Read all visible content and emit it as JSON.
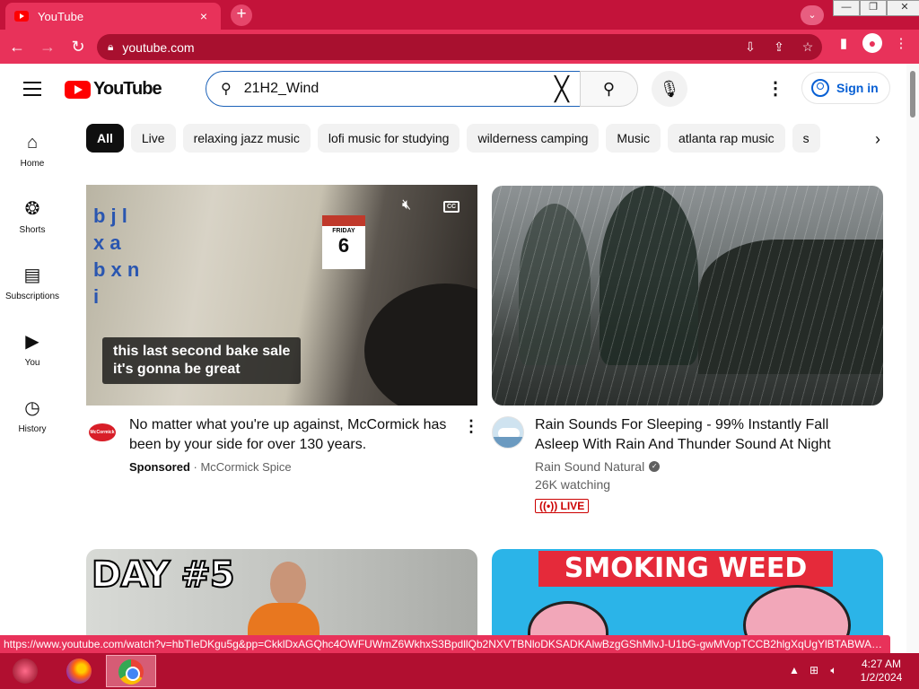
{
  "browser": {
    "tab_title": "YouTube",
    "tab_close": "×",
    "new_tab": "+",
    "tab_search": "⌄",
    "url": "youtube.com",
    "status_url": "https://www.youtube.com/watch?v=hbTIeDKgu5g&pp=CkklDxAGQhc4OWFUWmZ6WkhxS3BpdllQb2NXVTBNloDKSADKAlwBzgGShMlvJ-U1bG-gwMVopTCCB2hlgXqUgYlBTABWAJoA...",
    "win_minimize": "—",
    "win_maximize": "❐",
    "win_close": "✕"
  },
  "header": {
    "logo_text": "YouTube",
    "search_value": "21H2_Wind",
    "clear_symbol": "╳",
    "signin_label": "Sign in"
  },
  "sidebar": {
    "items": [
      {
        "label": "Home",
        "icon": "⌂"
      },
      {
        "label": "Shorts",
        "icon": "❂"
      },
      {
        "label": "Subscriptions",
        "icon": "▤"
      },
      {
        "label": "You",
        "icon": "▶"
      },
      {
        "label": "History",
        "icon": "◷"
      }
    ]
  },
  "chips": [
    "All",
    "Live",
    "relaxing jazz music",
    "lofi music for studying",
    "wilderness camping",
    "Music",
    "atlanta rap music",
    "s"
  ],
  "videos": [
    {
      "title": "No matter what you're up against, McCormick has been by your side for over 130 years.",
      "sponsored": "Sponsored",
      "separator": " · ",
      "channel": "McCormick Spice",
      "caption_line1": "this last second bake sale",
      "caption_line2": "it's gonna be great",
      "letters": "b j l\nx a\nb x n\ni",
      "cal_day": "FRIDAY",
      "cal_num": "6",
      "avatar_text": "McCormick",
      "cc_label": "CC"
    },
    {
      "title": "Rain Sounds For Sleeping - 99% Instantly Fall Asleep With Rain And Thunder Sound At Night",
      "channel": "Rain Sound Natural",
      "verified": "✓",
      "watching": "26K watching",
      "badge": "((•)) LIVE"
    },
    {
      "thumb_text": "DAY #5"
    },
    {
      "thumb_text": "SMOKING WEED"
    }
  ],
  "taskbar": {
    "time": "4:27 AM",
    "date": "1/2/2024"
  }
}
